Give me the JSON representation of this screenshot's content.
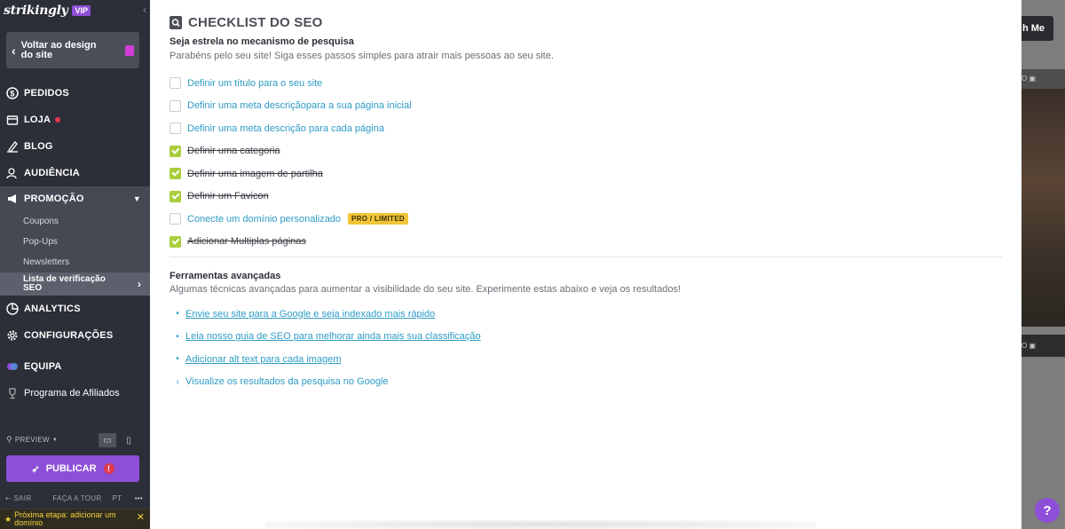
{
  "brand": {
    "logo": "strikingly",
    "badge": "VIP"
  },
  "sidebar": {
    "back_label": "Voltar ao design do site",
    "nav": [
      {
        "label": "PEDIDOS"
      },
      {
        "label": "LOJA"
      },
      {
        "label": "BLOG"
      },
      {
        "label": "AUDIÊNCIA"
      },
      {
        "label": "PROMOÇÃO"
      }
    ],
    "sub": [
      {
        "label": "Coupons"
      },
      {
        "label": "Pop-Ups"
      },
      {
        "label": "Newsletters"
      },
      {
        "label": "Lista de verificação SEO"
      }
    ],
    "nav2": [
      {
        "label": "ANALYTICS"
      },
      {
        "label": "CONFIGURAÇÕES"
      },
      {
        "label": "EQUIPA"
      },
      {
        "label": "Programa de Afiliados"
      }
    ],
    "preview": "PREVIEW",
    "publish": "PUBLICAR",
    "publish_alert": "!",
    "footer": {
      "exit": "SAIR",
      "tour": "FAÇA A TOUR",
      "lang": "PT",
      "more": "•••"
    },
    "next_step": "Próxima etapa: adicionar um domínio"
  },
  "main": {
    "title": "CHECKLIST DO SEO",
    "sec1_heading": "Seja estrela no mecanismo de pesquisa",
    "sec1_text": "Parabéns pelo seu site! Siga esses passos simples para atrair mais pessoas ao seu site.",
    "checklist": [
      {
        "label": "Definir um título para o seu site",
        "done": false
      },
      {
        "label": "Definir uma meta descriçãopara a sua página inicial",
        "done": false
      },
      {
        "label": "Definir uma meta descrição para cada página",
        "done": false
      },
      {
        "label": "Definir uma categoria",
        "done": true
      },
      {
        "label": "Definir uma imagem de partilha",
        "done": true
      },
      {
        "label": "Definir um Favicon",
        "done": true
      },
      {
        "label": "Conecte um domínio personalizado",
        "done": false,
        "badge": "PRO / LIMITED"
      },
      {
        "label": "Adicionar Multiplas páginas",
        "done": true
      }
    ],
    "sec2_heading": "Ferramentas avançadas",
    "sec2_text": "Algumas técnicas avançadas para aumentar a visibilidade do seu site. Experimente estas abaixo e veja os resultados!",
    "links": [
      {
        "label": "Envie seu site para a Google e seja indexado mais rápido",
        "bullet": "•"
      },
      {
        "label": "Leia nosso guia de SEO para melhorar ainda mais sua classificação",
        "bullet": "•"
      },
      {
        "label": "Adicionar alt text para cada imagem",
        "bullet": "•"
      },
      {
        "label": "Visualize os resultados da pesquisa no Google",
        "bullet": "›"
      }
    ]
  },
  "background": {
    "button_text": "h Me",
    "bar1": "O",
    "bar2": "O"
  },
  "help": "?",
  "colors": {
    "accent": "#8e4fd8",
    "link": "#2d9bc5",
    "check": "#a9cd3b",
    "badge": "#f2c437",
    "sidebar": "#2c2f38"
  }
}
